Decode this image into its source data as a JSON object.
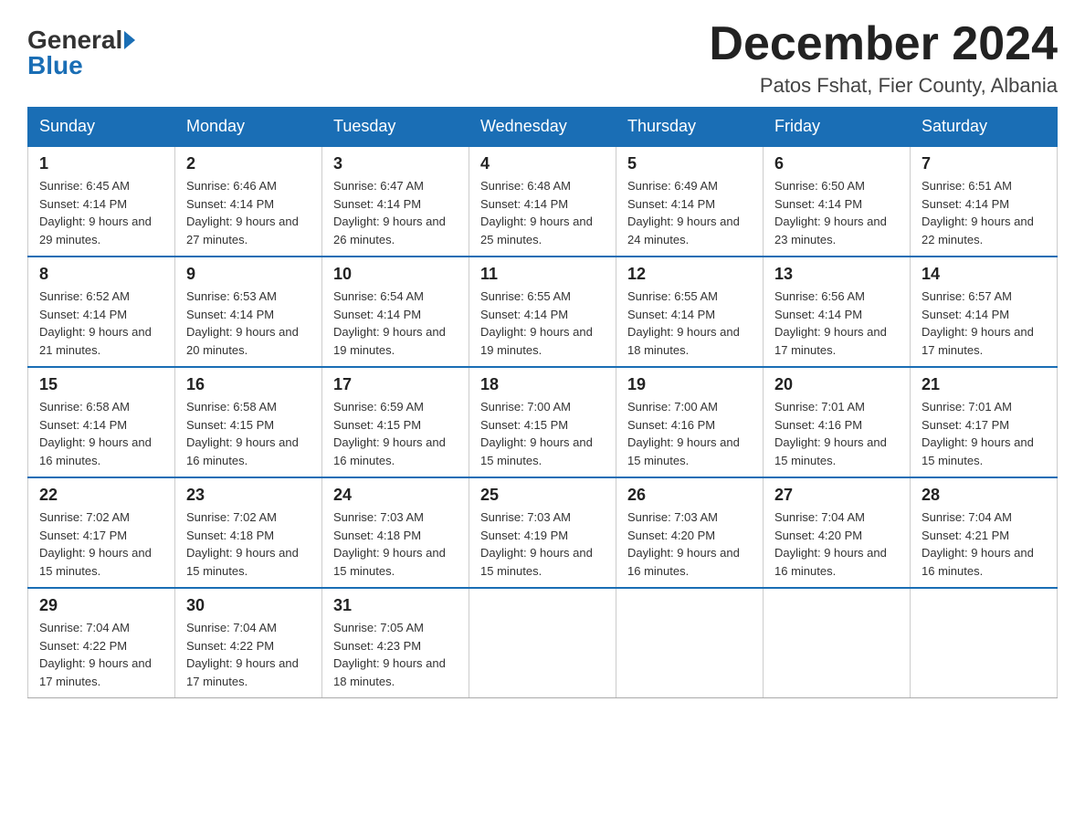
{
  "header": {
    "logo_general": "General",
    "logo_blue": "Blue",
    "title": "December 2024",
    "location": "Patos Fshat, Fier County, Albania"
  },
  "days_of_week": [
    "Sunday",
    "Monday",
    "Tuesday",
    "Wednesday",
    "Thursday",
    "Friday",
    "Saturday"
  ],
  "weeks": [
    [
      {
        "day": "1",
        "sunrise": "6:45 AM",
        "sunset": "4:14 PM",
        "daylight": "9 hours and 29 minutes."
      },
      {
        "day": "2",
        "sunrise": "6:46 AM",
        "sunset": "4:14 PM",
        "daylight": "9 hours and 27 minutes."
      },
      {
        "day": "3",
        "sunrise": "6:47 AM",
        "sunset": "4:14 PM",
        "daylight": "9 hours and 26 minutes."
      },
      {
        "day": "4",
        "sunrise": "6:48 AM",
        "sunset": "4:14 PM",
        "daylight": "9 hours and 25 minutes."
      },
      {
        "day": "5",
        "sunrise": "6:49 AM",
        "sunset": "4:14 PM",
        "daylight": "9 hours and 24 minutes."
      },
      {
        "day": "6",
        "sunrise": "6:50 AM",
        "sunset": "4:14 PM",
        "daylight": "9 hours and 23 minutes."
      },
      {
        "day": "7",
        "sunrise": "6:51 AM",
        "sunset": "4:14 PM",
        "daylight": "9 hours and 22 minutes."
      }
    ],
    [
      {
        "day": "8",
        "sunrise": "6:52 AM",
        "sunset": "4:14 PM",
        "daylight": "9 hours and 21 minutes."
      },
      {
        "day": "9",
        "sunrise": "6:53 AM",
        "sunset": "4:14 PM",
        "daylight": "9 hours and 20 minutes."
      },
      {
        "day": "10",
        "sunrise": "6:54 AM",
        "sunset": "4:14 PM",
        "daylight": "9 hours and 19 minutes."
      },
      {
        "day": "11",
        "sunrise": "6:55 AM",
        "sunset": "4:14 PM",
        "daylight": "9 hours and 19 minutes."
      },
      {
        "day": "12",
        "sunrise": "6:55 AM",
        "sunset": "4:14 PM",
        "daylight": "9 hours and 18 minutes."
      },
      {
        "day": "13",
        "sunrise": "6:56 AM",
        "sunset": "4:14 PM",
        "daylight": "9 hours and 17 minutes."
      },
      {
        "day": "14",
        "sunrise": "6:57 AM",
        "sunset": "4:14 PM",
        "daylight": "9 hours and 17 minutes."
      }
    ],
    [
      {
        "day": "15",
        "sunrise": "6:58 AM",
        "sunset": "4:14 PM",
        "daylight": "9 hours and 16 minutes."
      },
      {
        "day": "16",
        "sunrise": "6:58 AM",
        "sunset": "4:15 PM",
        "daylight": "9 hours and 16 minutes."
      },
      {
        "day": "17",
        "sunrise": "6:59 AM",
        "sunset": "4:15 PM",
        "daylight": "9 hours and 16 minutes."
      },
      {
        "day": "18",
        "sunrise": "7:00 AM",
        "sunset": "4:15 PM",
        "daylight": "9 hours and 15 minutes."
      },
      {
        "day": "19",
        "sunrise": "7:00 AM",
        "sunset": "4:16 PM",
        "daylight": "9 hours and 15 minutes."
      },
      {
        "day": "20",
        "sunrise": "7:01 AM",
        "sunset": "4:16 PM",
        "daylight": "9 hours and 15 minutes."
      },
      {
        "day": "21",
        "sunrise": "7:01 AM",
        "sunset": "4:17 PM",
        "daylight": "9 hours and 15 minutes."
      }
    ],
    [
      {
        "day": "22",
        "sunrise": "7:02 AM",
        "sunset": "4:17 PM",
        "daylight": "9 hours and 15 minutes."
      },
      {
        "day": "23",
        "sunrise": "7:02 AM",
        "sunset": "4:18 PM",
        "daylight": "9 hours and 15 minutes."
      },
      {
        "day": "24",
        "sunrise": "7:03 AM",
        "sunset": "4:18 PM",
        "daylight": "9 hours and 15 minutes."
      },
      {
        "day": "25",
        "sunrise": "7:03 AM",
        "sunset": "4:19 PM",
        "daylight": "9 hours and 15 minutes."
      },
      {
        "day": "26",
        "sunrise": "7:03 AM",
        "sunset": "4:20 PM",
        "daylight": "9 hours and 16 minutes."
      },
      {
        "day": "27",
        "sunrise": "7:04 AM",
        "sunset": "4:20 PM",
        "daylight": "9 hours and 16 minutes."
      },
      {
        "day": "28",
        "sunrise": "7:04 AM",
        "sunset": "4:21 PM",
        "daylight": "9 hours and 16 minutes."
      }
    ],
    [
      {
        "day": "29",
        "sunrise": "7:04 AM",
        "sunset": "4:22 PM",
        "daylight": "9 hours and 17 minutes."
      },
      {
        "day": "30",
        "sunrise": "7:04 AM",
        "sunset": "4:22 PM",
        "daylight": "9 hours and 17 minutes."
      },
      {
        "day": "31",
        "sunrise": "7:05 AM",
        "sunset": "4:23 PM",
        "daylight": "9 hours and 18 minutes."
      },
      null,
      null,
      null,
      null
    ]
  ]
}
